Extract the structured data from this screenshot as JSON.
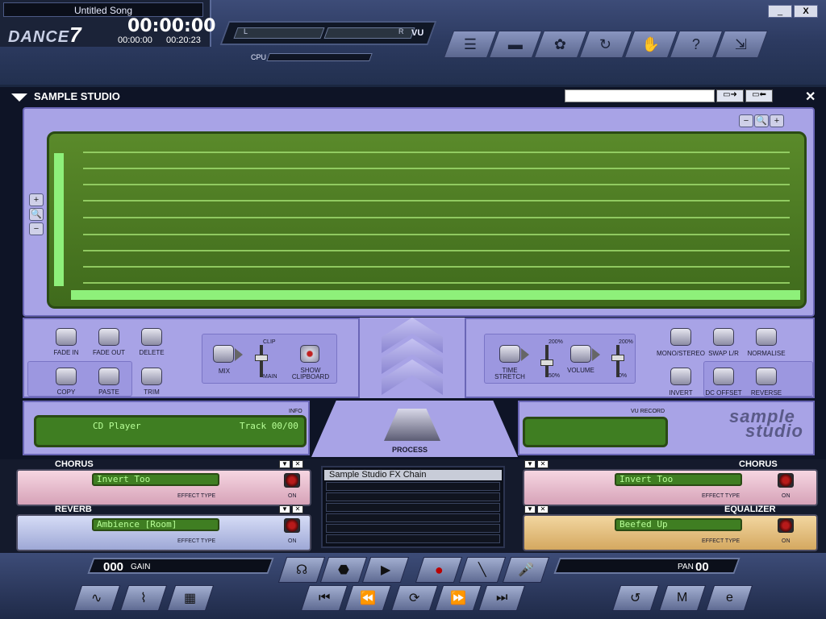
{
  "app": {
    "brand_small": "DANCE",
    "brand_big": "7",
    "song_title": "Untitled Song",
    "time_main": "00:00:00",
    "time_elapsed": "00:00:00",
    "time_total": "00:20:23"
  },
  "meters": {
    "vu_left": "L",
    "vu_right": "R",
    "vu_label": "VU",
    "cpu_label": "CPU"
  },
  "toolbar": {
    "icons": [
      "list-icon",
      "folder-icon",
      "gear-drum-icon",
      "rotate-icon",
      "hands-icon",
      "help-icon",
      "minimize-window-icon"
    ]
  },
  "window_controls": {
    "minimize": "_",
    "close": "X"
  },
  "studio": {
    "title": "SAMPLE STUDIO",
    "close": "✕",
    "name_field": "",
    "zoom_h": [
      "−",
      "🔍",
      "+"
    ],
    "zoom_v": [
      "+",
      "🔍",
      "−"
    ]
  },
  "left_controls": {
    "fade_in": "FADE IN",
    "fade_out": "FADE OUT",
    "delete": "DELETE",
    "copy": "COPY",
    "paste": "PASTE",
    "trim": "TRIM",
    "mix": "MIX",
    "clip": "CLIP",
    "main": "MAIN",
    "show_clipboard_1": "SHOW",
    "show_clipboard_2": "CLIPBOARD"
  },
  "right_controls": {
    "time_1": "TIME",
    "time_2": "STRETCH",
    "max_time": "200%",
    "min_time": "50%",
    "volume": "VOLUME",
    "max_vol": "200%",
    "min_vol": "0%",
    "mono_stereo": "MONO/STEREO",
    "swap": "SWAP L/R",
    "normalise": "NORMALISE",
    "invert": "INVERT",
    "dc_offset": "DC OFFSET",
    "reverse": "REVERSE"
  },
  "info": {
    "label": "INFO",
    "source": "CD Player",
    "track": "Track 00/00"
  },
  "process": {
    "label": "PROCESS"
  },
  "vu_record": {
    "label": "VU RECORD"
  },
  "logo": {
    "line1": "sample",
    "line2": "studio"
  },
  "fx": {
    "chorus_left": {
      "title": "CHORUS",
      "name": "Invert Too",
      "effect_type": "EFFECT TYPE",
      "on": "ON"
    },
    "reverb": {
      "title": "REVERB",
      "name": "Ambience [Room]",
      "effect_type": "EFFECT TYPE",
      "on": "ON"
    },
    "chorus_right": {
      "title": "CHORUS",
      "name": "Invert Too",
      "effect_type": "EFFECT TYPE",
      "on": "ON"
    },
    "equalizer": {
      "title": "EQUALIZER",
      "name": "Beefed Up",
      "effect_type": "EFFECT TYPE",
      "on": "ON"
    },
    "chain_title": "Sample Studio FX Chain"
  },
  "bottom": {
    "gain_value": "000",
    "gain_label": "GAIN",
    "pan_label": "PAN",
    "pan_value": "00",
    "transport": [
      "ear-icon",
      "stop-icon",
      "play-icon",
      "record-icon",
      "wand-icon",
      "mic-icon"
    ],
    "transport2": [
      "skip-back-icon",
      "rewind-icon",
      "loop-icon",
      "fast-forward-icon",
      "skip-forward-icon"
    ],
    "left_icons": [
      "wave-icon",
      "waveform-edit-icon",
      "film-icon"
    ],
    "right_icons": [
      "loop-back-icon",
      "mixer-icon",
      "eq-icon"
    ]
  }
}
